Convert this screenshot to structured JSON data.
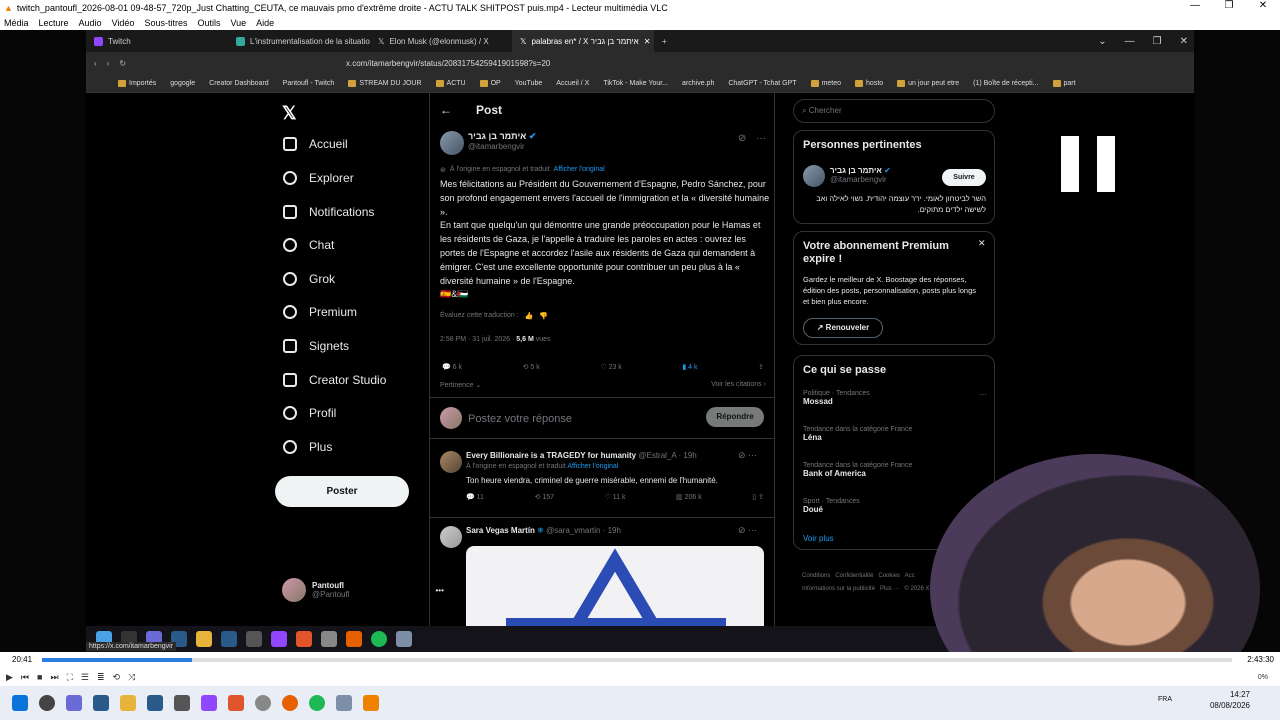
{
  "vlc": {
    "title": "twitch_pantoufl_2026-08-01 09-48-57_720p_Just Chatting_CEUTA, ce mauvais pmo d'extrême droite - ACTU TALK SHITPOST puis.mp4 - Lecteur multimédia VLC",
    "menu": [
      "Média",
      "Lecture",
      "Audio",
      "Vidéo",
      "Sous-titres",
      "Outils",
      "Vue",
      "Aide"
    ],
    "time_current": "20:41",
    "time_total": "2:43:30",
    "progress": 0.126,
    "volume": "0%"
  },
  "browser": {
    "tabs": [
      "Twitch",
      "L'instrumentalisation de la situation :",
      "Elon Musk (@elonmusk) / X",
      "palabras en* / X איתמר בן גביר"
    ],
    "url": "x.com/itamarbengvir/status/2083175425941901598?s=20",
    "bookmarks": [
      "Importés",
      "gogogle",
      "Creator Dashboard",
      "Pantoufl - Twitch",
      "STREAM DU JOUR",
      "ACTU",
      "OP",
      "YouTube",
      "Accueil / X",
      "TikTok - Make Your...",
      "archive.ph",
      "ChatGPT - Tchat GPT",
      "meteo",
      "hosto",
      "un jour peut etre",
      "(1) Boîte de récepti...",
      "part"
    ]
  },
  "nav": {
    "items": [
      "Accueil",
      "Explorer",
      "Notifications",
      "Chat",
      "Grok",
      "Premium",
      "Signets",
      "Creator Studio",
      "Profil",
      "Plus"
    ],
    "post_button": "Poster",
    "profile_name": "Pantoufl",
    "profile_handle": "@Pantoufl"
  },
  "post": {
    "header": "Post",
    "author": "איתמר בן גביר",
    "handle": "@itamarbengvir",
    "translated_note": "À l'origine en espagnol et traduit",
    "show_original": "Afficher l'original",
    "p1": "Mes félicitations au Président du Gouvernement d'Espagne, Pedro Sánchez, pour son profond engagement envers l'accueil de l'immigration et la « diversité humaine ».",
    "p2": "En tant que quelqu'un qui démontre une grande préoccupation pour le Hamas et les résidents de Gaza, je l'appelle à traduire les paroles en actes : ouvrez les portes de l'Espagne et accordez l'asile aux résidents de Gaza qui demandent à émigrer. C'est une excellente opportunité pour contribuer un peu plus à la « diversité humaine » de l'Espagne.",
    "flags": "🇪🇸&🇵🇸",
    "rate": "Évaluez cette traduction :",
    "time": "2:58 PM · 31 juil. 2026 ·",
    "views": "5,6 M",
    "views_label": "vues",
    "replies": "6 k",
    "reposts": "5 k",
    "likes": "23 k",
    "bookmarks": "4 k",
    "relevance": "Pertinence",
    "citations": "Voir les citations",
    "reply_placeholder": "Postez votre réponse",
    "reply_button": "Répondre"
  },
  "replies": [
    {
      "name": "Every Billionaire is a TRAGEDY for humanity",
      "handle": "@Estral_A · 19h",
      "note": "À l'origine en espagnol et traduit",
      "show_original": "Afficher l'original",
      "text": "Ton heure viendra, criminel de guerre misérable, ennemi de l'humanité.",
      "r": "11",
      "rt": "157",
      "l": "11 k",
      "v": "206 k"
    },
    {
      "name": "Sara Vegas Martín",
      "handle": "@sara_vmartin · 19h"
    }
  ],
  "right": {
    "search_placeholder": "Chercher",
    "pertinent_title": "Personnes pertinentes",
    "p_name": "איתמר בן גביר",
    "p_handle": "@itamarbengvir",
    "follow": "Suivre",
    "p_bio": "השר לביטחון לאומי. יו\"ר עוצמה יהודית. נשוי לאילה ואב לשישה ילדים מתוקים.",
    "premium_title": "Votre abonnement Premium expire !",
    "premium_text": "Gardez le meilleur de X. Boostage des réponses, édition des posts, personnalisation, posts plus longs et bien plus encore.",
    "renew": "Renouveler",
    "trends_title": "Ce qui se passe",
    "trends": [
      {
        "cat": "Politique · Tendances",
        "name": "Mossad"
      },
      {
        "cat": "Tendance dans la catégorie France",
        "name": "Léna"
      },
      {
        "cat": "Tendance dans la catégorie France",
        "name": "Bank of America"
      },
      {
        "cat": "Sport · Tendances",
        "name": "Doué"
      }
    ],
    "more": "Voir plus",
    "footer": "Conditions   Confidentialité   Cookies   Acc",
    "footer2": "Informations sur la publicité   Plus ···   © 2026 X C"
  },
  "tooltip": "https://x.com/itamarbengvir",
  "clock": {
    "time": "14:27",
    "date": "08/08/2026",
    "lang": "FRA"
  }
}
